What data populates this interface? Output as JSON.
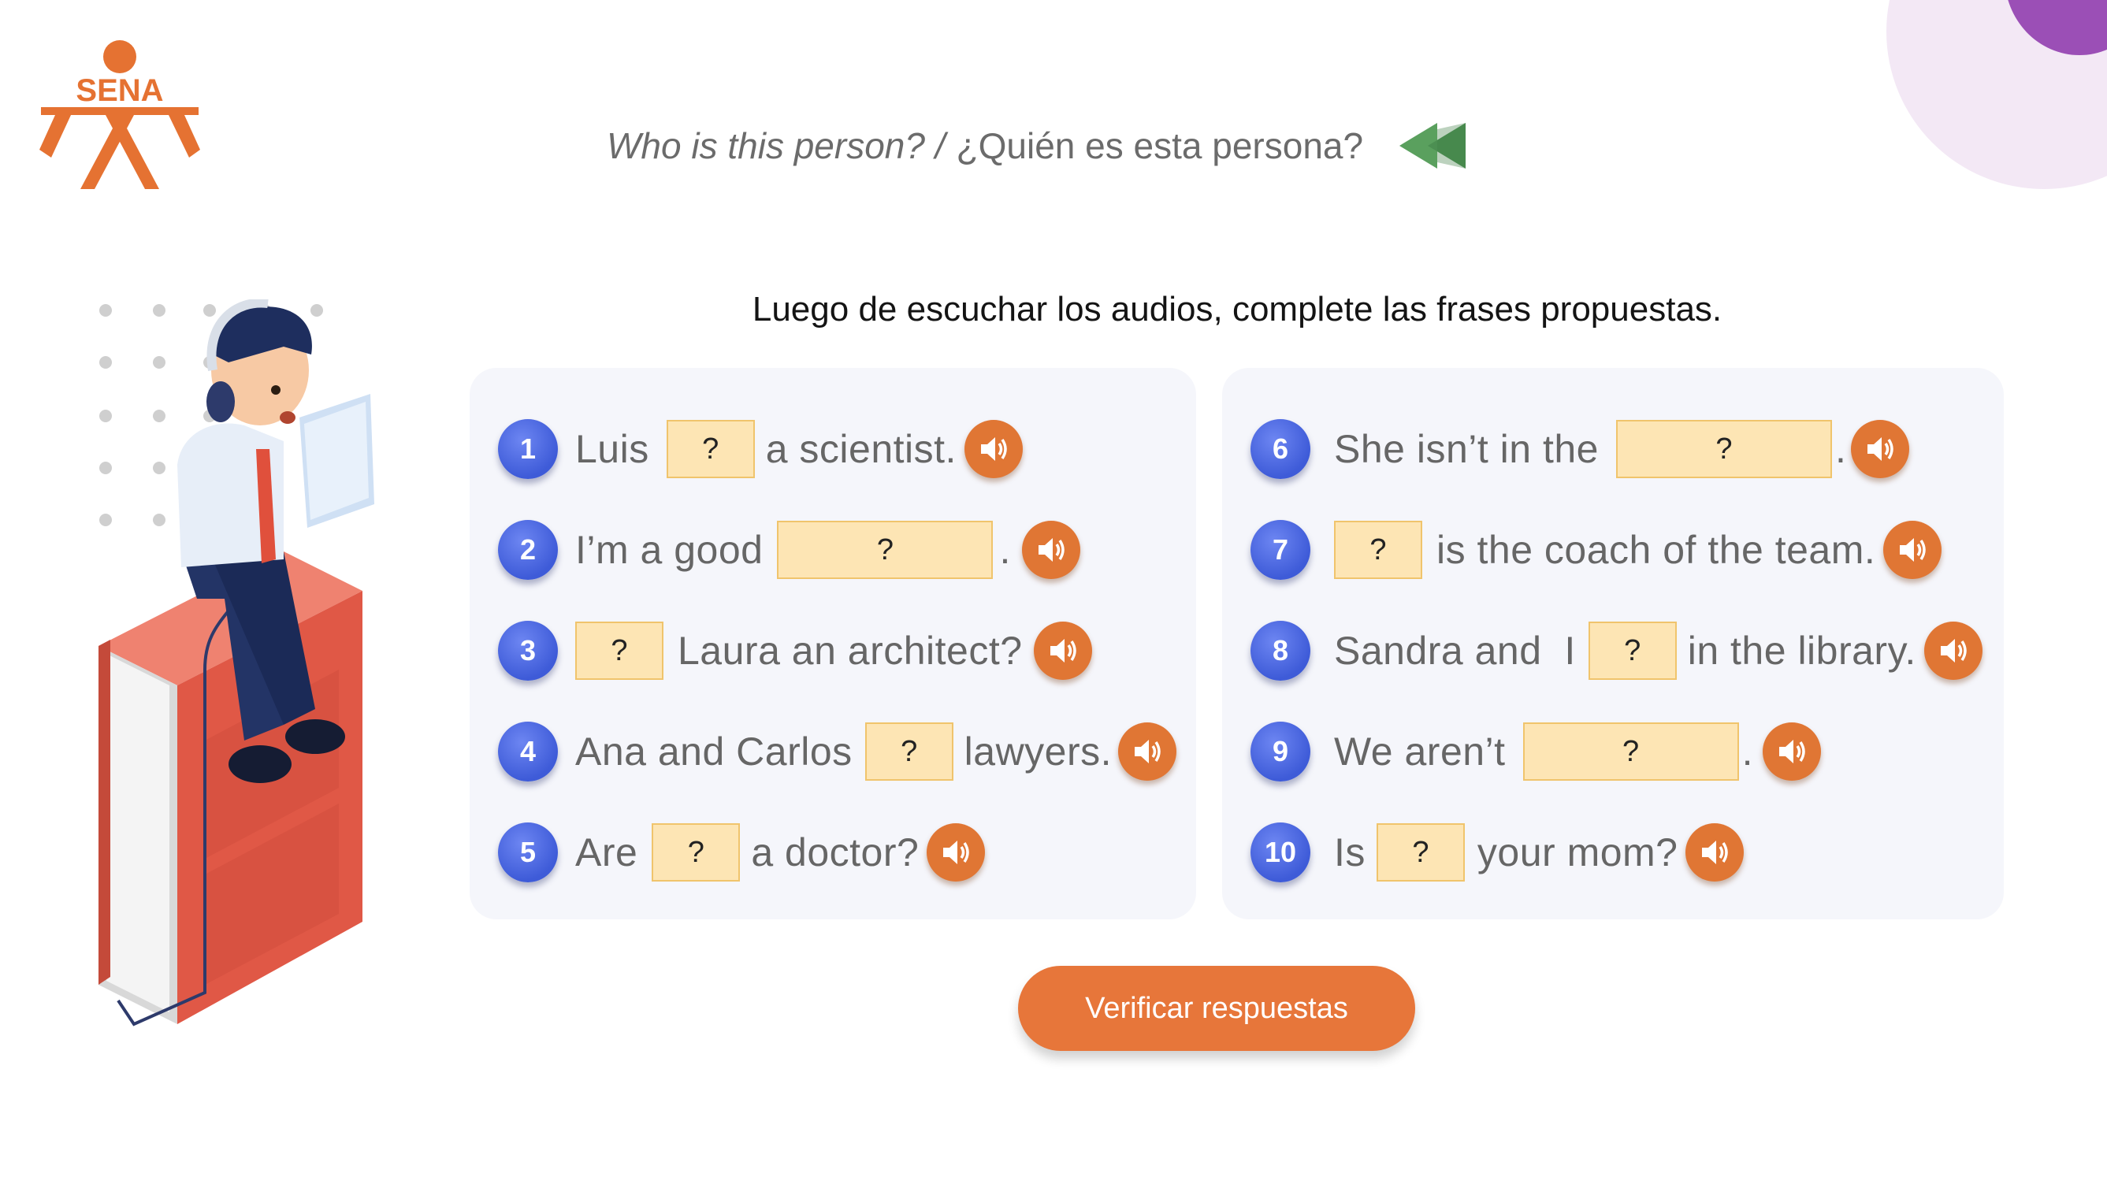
{
  "header": {
    "title_en": "Who is this person? /",
    "title_es": "¿Quién es esta persona?",
    "logo_text": "SENA"
  },
  "instruction": "Luego de escuchar los audios, complete las frases propuestas.",
  "blank_symbol": "?",
  "exercises": [
    {
      "number": "1",
      "parts": [
        "Luis",
        "a scientist."
      ]
    },
    {
      "number": "2",
      "parts": [
        "I’m a good",
        "."
      ]
    },
    {
      "number": "3",
      "parts": [
        "Laura an architect?"
      ]
    },
    {
      "number": "4",
      "parts": [
        "Ana and Carlos",
        "lawyers."
      ]
    },
    {
      "number": "5",
      "parts": [
        "Are",
        "a doctor?"
      ]
    },
    {
      "number": "6",
      "parts": [
        "She isn’t in the",
        "."
      ]
    },
    {
      "number": "7",
      "parts": [
        "is the coach of the team."
      ]
    },
    {
      "number": "8",
      "parts": [
        "Sandra and  I",
        "in the library."
      ]
    },
    {
      "number": "9",
      "parts": [
        "We aren’t",
        "."
      ]
    },
    {
      "number": "10",
      "parts": [
        "Is",
        "your mom?"
      ]
    }
  ],
  "verify_button": "Verificar respuestas",
  "colors": {
    "accent_orange": "#e7763a",
    "number_blue": "#4a64e0",
    "blank_fill": "#fde5b4",
    "rewind_green": "#5aa05e",
    "corner_purple": "#9b4fb6"
  }
}
